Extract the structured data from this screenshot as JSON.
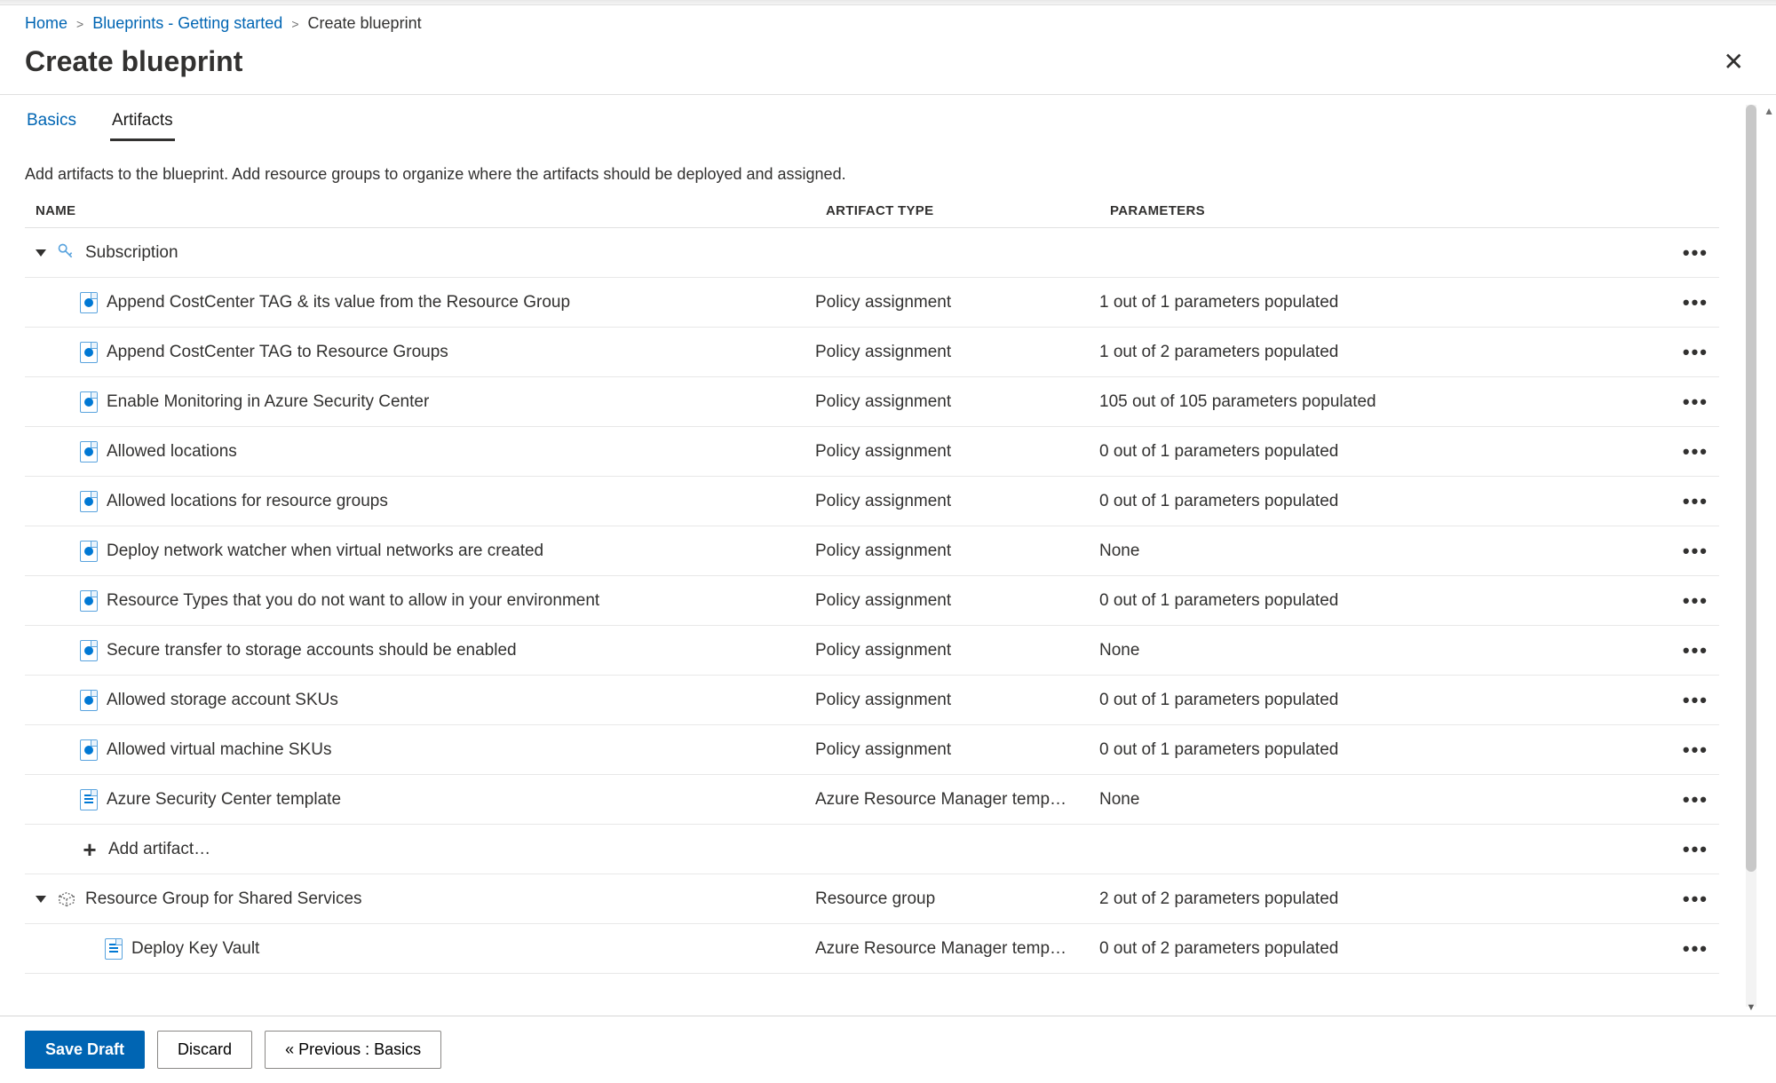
{
  "breadcrumb": {
    "home": "Home",
    "mid": "Blueprints - Getting started",
    "current": "Create blueprint"
  },
  "page_title": "Create blueprint",
  "tabs": {
    "basics": "Basics",
    "artifacts": "Artifacts"
  },
  "description": "Add artifacts to the blueprint. Add resource groups to organize where the artifacts should be deployed and assigned.",
  "columns": {
    "name": "NAME",
    "type": "ARTIFACT TYPE",
    "params": "PARAMETERS"
  },
  "rows": [
    {
      "indent": 0,
      "icon": "key",
      "caret": true,
      "name": "Subscription",
      "type": "",
      "params": "",
      "dots": true
    },
    {
      "indent": 1,
      "icon": "policy",
      "name": "Append CostCenter TAG & its value from the Resource Group",
      "type": "Policy assignment",
      "params": "1 out of 1 parameters populated",
      "dots": true
    },
    {
      "indent": 1,
      "icon": "policy",
      "name": "Append CostCenter TAG to Resource Groups",
      "type": "Policy assignment",
      "params": "1 out of 2 parameters populated",
      "dots": true
    },
    {
      "indent": 1,
      "icon": "policy",
      "name": "Enable Monitoring in Azure Security Center",
      "type": "Policy assignment",
      "params": "105 out of 105 parameters populated",
      "dots": true
    },
    {
      "indent": 1,
      "icon": "policy",
      "name": "Allowed locations",
      "type": "Policy assignment",
      "params": "0 out of 1 parameters populated",
      "dots": true
    },
    {
      "indent": 1,
      "icon": "policy",
      "name": "Allowed locations for resource groups",
      "type": "Policy assignment",
      "params": "0 out of 1 parameters populated",
      "dots": true
    },
    {
      "indent": 1,
      "icon": "policy",
      "name": "Deploy network watcher when virtual networks are created",
      "type": "Policy assignment",
      "params": "None",
      "dots": true
    },
    {
      "indent": 1,
      "icon": "policy",
      "name": "Resource Types that you do not want to allow in your environment",
      "type": "Policy assignment",
      "params": "0 out of 1 parameters populated",
      "dots": true
    },
    {
      "indent": 1,
      "icon": "policy",
      "name": "Secure transfer to storage accounts should be enabled",
      "type": "Policy assignment",
      "params": "None",
      "dots": true
    },
    {
      "indent": 1,
      "icon": "policy",
      "name": "Allowed storage account SKUs",
      "type": "Policy assignment",
      "params": "0 out of 1 parameters populated",
      "dots": true
    },
    {
      "indent": 1,
      "icon": "policy",
      "name": "Allowed virtual machine SKUs",
      "type": "Policy assignment",
      "params": "0 out of 1 parameters populated",
      "dots": true
    },
    {
      "indent": 1,
      "icon": "template",
      "name": "Azure Security Center template",
      "type": "Azure Resource Manager temp…",
      "params": "None",
      "dots": true
    },
    {
      "indent": 1,
      "icon": "plus",
      "name": "Add artifact…",
      "type": "",
      "params": "",
      "dots": true,
      "action": true
    },
    {
      "indent": 0,
      "icon": "rg",
      "caret": true,
      "name": "Resource Group for Shared Services",
      "type": "Resource group",
      "params": "2 out of 2 parameters populated",
      "dots": true
    },
    {
      "indent": 2,
      "icon": "template",
      "name": "Deploy Key Vault",
      "type": "Azure Resource Manager temp…",
      "params": "0 out of 2 parameters populated",
      "dots": true
    }
  ],
  "footer": {
    "save": "Save Draft",
    "discard": "Discard",
    "prev": "« Previous : Basics"
  }
}
